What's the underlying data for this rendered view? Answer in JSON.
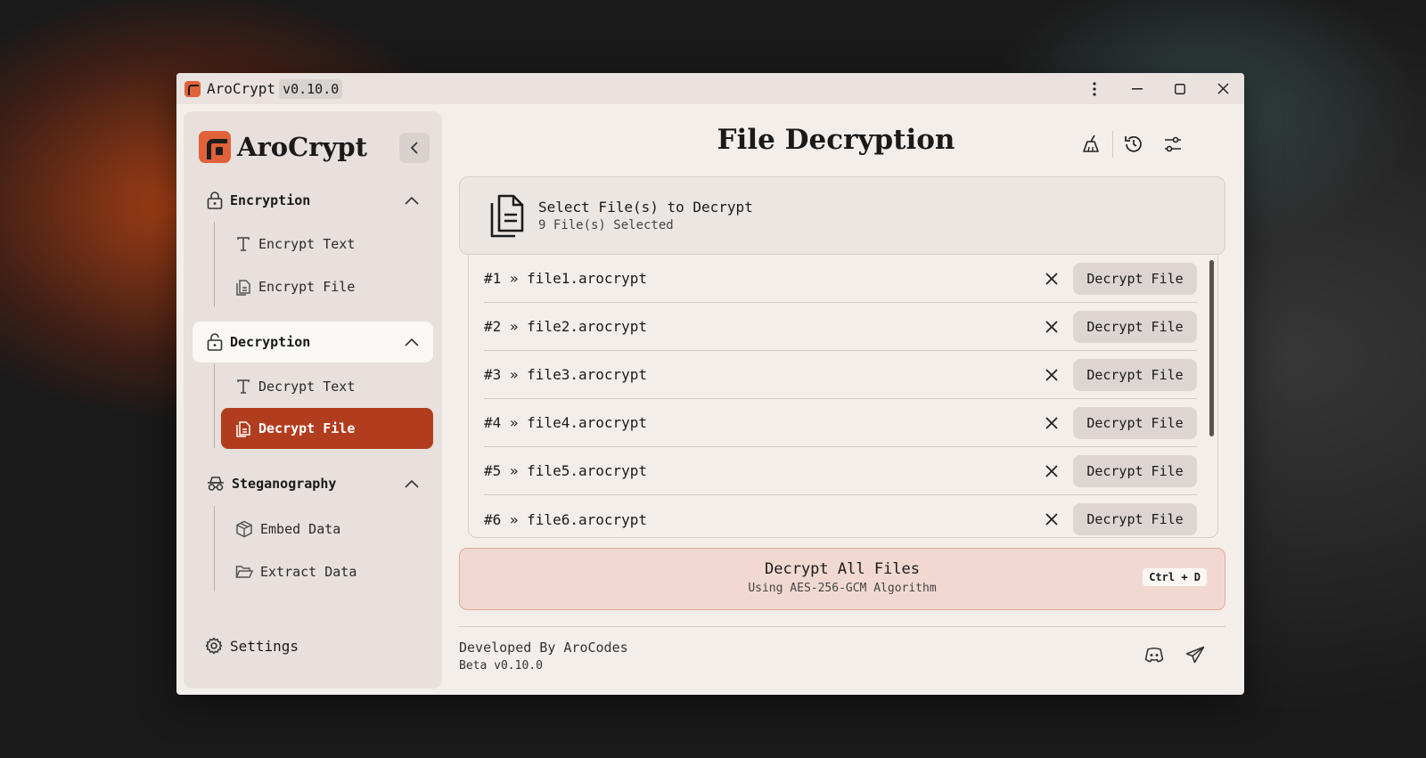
{
  "titlebar": {
    "app_name": "AroCrypt",
    "version": "v0.10.0"
  },
  "sidebar": {
    "brand": "AroCrypt",
    "sections": [
      {
        "label": "Encryption",
        "items": [
          "Encrypt Text",
          "Encrypt File"
        ]
      },
      {
        "label": "Decryption",
        "items": [
          "Decrypt Text",
          "Decrypt File"
        ]
      },
      {
        "label": "Steganography",
        "items": [
          "Embed Data",
          "Extract Data"
        ]
      }
    ],
    "settings_label": "Settings"
  },
  "main": {
    "title": "File Decryption",
    "select": {
      "title": "Select File(s) to Decrypt",
      "subtitle": "9 File(s) Selected"
    },
    "files": [
      {
        "name": "#1 » file1.arocrypt",
        "action": "Decrypt File"
      },
      {
        "name": "#2 » file2.arocrypt",
        "action": "Decrypt File"
      },
      {
        "name": "#3 » file3.arocrypt",
        "action": "Decrypt File"
      },
      {
        "name": "#4 » file4.arocrypt",
        "action": "Decrypt File"
      },
      {
        "name": "#5 » file5.arocrypt",
        "action": "Decrypt File"
      },
      {
        "name": "#6 » file6.arocrypt",
        "action": "Decrypt File"
      }
    ],
    "decrypt_all": {
      "title": "Decrypt All Files",
      "subtitle": "Using AES-256-GCM Algorithm",
      "shortcut": "Ctrl + D"
    }
  },
  "footer": {
    "developer": "Developed By AroCodes",
    "version": "Beta v0.10.0"
  },
  "colors": {
    "accent": "#b23d1e",
    "logo": "#e0623a",
    "decrypt_all_bg": "#f1d9d1"
  }
}
